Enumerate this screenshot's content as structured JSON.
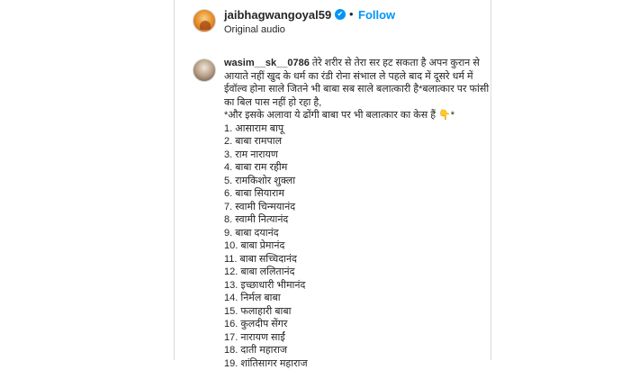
{
  "post_header": {
    "username": "jaibhagwangoyal59",
    "verified_glyph": "✔",
    "separator": "•",
    "follow_label": "Follow",
    "audio_label": "Original audio"
  },
  "comment": {
    "username": "wasim__sk__0786",
    "text": "तेरे शरीर से तेरा सर हट सकता है अपन कुरान से आयाते नहीं खुद के धर्म का रंडी रोना संभाल ले पहले बाद में दूसरे धर्म में ईवॉल्व होना साले जितने भी बाबा सब साले बलात्कारी है*बलात्कार पर फांसी का बिल पास नहीं हो रहा है,\n*और इसके अलावा ये ढोंगी बाबा पर भी बलात्कार का केस हैं 👇*\n1. आसाराम बापू\n2. बाबा रामपाल\n3. राम नारायण\n4. बाबा राम रहीम\n5. रामकिशोर शुक्ला\n6. बाबा सियाराम\n7. स्वामी चिन्मयानंद\n8. स्वामी नित्यानंद\n9. बाबा दयानंद\n10. बाबा प्रेमानंद\n11. बाबा सच्चिदानंद\n12. बाबा ललितानंद\n13. इच्छाधारी भीमानंद\n14. निर्मल बाबा\n15. फलाहारी बाबा\n16. कुलदीप सेंगर\n17. नारायण साईं\n18. दाती महाराज\n19. शांतिसागर महाराज"
  },
  "colors": {
    "link": "#0095f6",
    "text": "#262626",
    "border": "#dbdbdb"
  },
  "icons": {
    "verified": "verified-badge-icon"
  }
}
